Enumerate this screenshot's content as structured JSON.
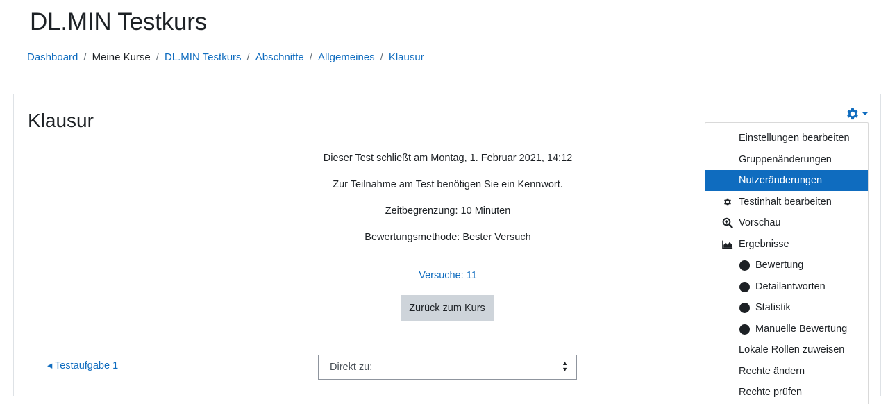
{
  "header": {
    "title": "DL.MIN Testkurs"
  },
  "breadcrumb": [
    {
      "label": "Dashboard",
      "link": true
    },
    {
      "label": "Meine Kurse",
      "link": false
    },
    {
      "label": "DL.MIN Testkurs",
      "link": true
    },
    {
      "label": "Abschnitte",
      "link": true
    },
    {
      "label": "Allgemeines",
      "link": true
    },
    {
      "label": "Klausur",
      "link": true
    }
  ],
  "quiz": {
    "title": "Klausur",
    "close_info": "Dieser Test schließt am Montag, 1. Februar 2021, 14:12",
    "password_info": "Zur Teilnahme am Test benötigen Sie ein Kennwort.",
    "time_limit": "Zeitbegrenzung: 10 Minuten",
    "grading_method": "Bewertungsmethode: Bester Versuch",
    "attempts_link": "Versuche: 11",
    "back_button": "Zurück zum Kurs"
  },
  "navigation": {
    "prev_link": "◂ Testaufgabe 1",
    "jump_select": {
      "selected": "Direkt zu:"
    }
  },
  "settings_menu": {
    "icon": "gear-icon",
    "items": [
      {
        "label": "Einstellungen bearbeiten",
        "icon": null,
        "sub": false,
        "active": false
      },
      {
        "label": "Gruppenänderungen",
        "icon": null,
        "sub": false,
        "active": false
      },
      {
        "label": "Nutzeränderungen",
        "icon": null,
        "sub": false,
        "active": true
      },
      {
        "label": "Testinhalt bearbeiten",
        "icon": "gear-icon",
        "sub": false,
        "active": false
      },
      {
        "label": "Vorschau",
        "icon": "zoom-icon",
        "sub": false,
        "active": false
      },
      {
        "label": "Ergebnisse",
        "icon": "area-chart-icon",
        "sub": false,
        "active": false
      },
      {
        "label": "Bewertung",
        "icon": "bullet-icon",
        "sub": true,
        "active": false
      },
      {
        "label": "Detailantworten",
        "icon": "bullet-icon",
        "sub": true,
        "active": false
      },
      {
        "label": "Statistik",
        "icon": "bullet-icon",
        "sub": true,
        "active": false
      },
      {
        "label": "Manuelle Bewertung",
        "icon": "bullet-icon",
        "sub": true,
        "active": false
      },
      {
        "label": "Lokale Rollen zuweisen",
        "icon": null,
        "sub": false,
        "active": false
      },
      {
        "label": "Rechte ändern",
        "icon": null,
        "sub": false,
        "active": false
      },
      {
        "label": "Rechte prüfen",
        "icon": null,
        "sub": false,
        "active": false
      }
    ]
  },
  "colors": {
    "link": "#0f6cbf",
    "active_bg": "#0f6cbf",
    "button_bg": "#ced4da",
    "text": "#1d2125"
  }
}
